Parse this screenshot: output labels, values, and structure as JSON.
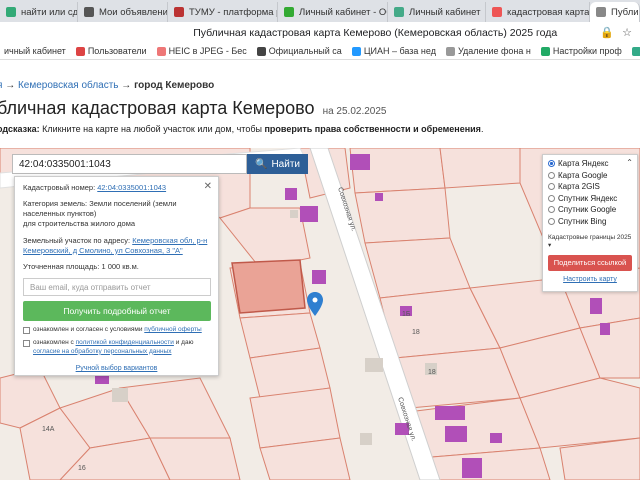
{
  "browser": {
    "tabs": [
      {
        "label": "найти или сдайте",
        "color": "#3a7"
      },
      {
        "label": "Мои объявления",
        "color": "#555"
      },
      {
        "label": "ТУМУ - платформа ре",
        "color": "#b33"
      },
      {
        "label": "Личный кабинет - Обь",
        "color": "#3a3"
      },
      {
        "label": "Личный кабинет",
        "color": "#4a8"
      },
      {
        "label": "кадастровая карта пу",
        "color": "#e55"
      },
      {
        "label": "Публичная",
        "color": "#888"
      }
    ],
    "active_tab_index": 6,
    "page_title": "Публичная кадастровая карта Кемерово (Кемеровская область) 2025 года",
    "bookmarks": [
      {
        "label": "ичный кабинет",
        "color": "#999"
      },
      {
        "label": "Пользователи",
        "color": "#d44"
      },
      {
        "label": "HEIC в JPEG - Бес",
        "color": "#e77"
      },
      {
        "label": "Официальный са",
        "color": "#444"
      },
      {
        "label": "ЦИАН – база нед",
        "color": "#29f"
      },
      {
        "label": "Удаление фона н",
        "color": "#999"
      },
      {
        "label": "Настройки проф",
        "color": "#2a6"
      },
      {
        "label": "Личный кабинет",
        "color": "#3a8"
      }
    ]
  },
  "breadcrumbs": {
    "root": "я",
    "region": "Кемеровская область",
    "city": "город Кемерово"
  },
  "heading": {
    "title": "бличная кадастровая карта Кемерово",
    "date": "на 25.02.2025"
  },
  "hint": {
    "label": "одсказка:",
    "text": "Кликните на карте на любой участок или дом, чтобы",
    "bold": "проверить права собственности и обременения"
  },
  "search": {
    "value": "42:04:0335001:1043",
    "button": "Найти"
  },
  "popup": {
    "cadastral_label": "Кадастровый номер:",
    "cadastral_value": "42:04:0335001:1043",
    "category_label": "Категория земель:",
    "category_value": "Земли поселений (земли населенных пунктов)",
    "use_value": "для строительства жилого дома",
    "address_label": "Земельный участок по адресу:",
    "address_value": "Кемеровская обл, р-н Кемеровский, д Смолино, ул Совхозная, 3 \"А\"",
    "area_label": "Уточненная площадь:",
    "area_value": "1 000 кв.м.",
    "email_placeholder": "Ваш email, куда отправить отчет",
    "report_button": "Получить подробный отчет",
    "consent1_text": "ознакомлен и согласен с условиями",
    "consent1_link": "публичной оферты",
    "consent2_text": "ознакомлен с",
    "consent2_link": "политикой конфиденциальности",
    "consent2_text2": "и даю",
    "consent2_link2": "согласие на обработку персональных данных",
    "manual_link": "Ручной выбор вариантов"
  },
  "layers": {
    "options": [
      {
        "label": "Карта Яндекс",
        "selected": true
      },
      {
        "label": "Карта Google",
        "selected": false
      },
      {
        "label": "Карта 2GIS",
        "selected": false
      },
      {
        "label": "Спутник Яндекс",
        "selected": false
      },
      {
        "label": "Спутник Google",
        "selected": false
      },
      {
        "label": "Спутник Bing",
        "selected": false
      }
    ],
    "boundaries": "Кадастровые границы 2025",
    "share": "Поделиться ссылкой",
    "reset": "Настроить карту"
  },
  "map": {
    "street_label": "Совхозная ул.",
    "house_labels": [
      "1Б",
      "18",
      "18",
      "14А",
      "16"
    ],
    "colors": {
      "plot_fill": "#f6e1dc",
      "plot_stroke": "#d9826f",
      "road": "#ffffff",
      "building": "#b14fb8",
      "selected": "#e88a7a",
      "marker": "#2f7fd0"
    }
  }
}
